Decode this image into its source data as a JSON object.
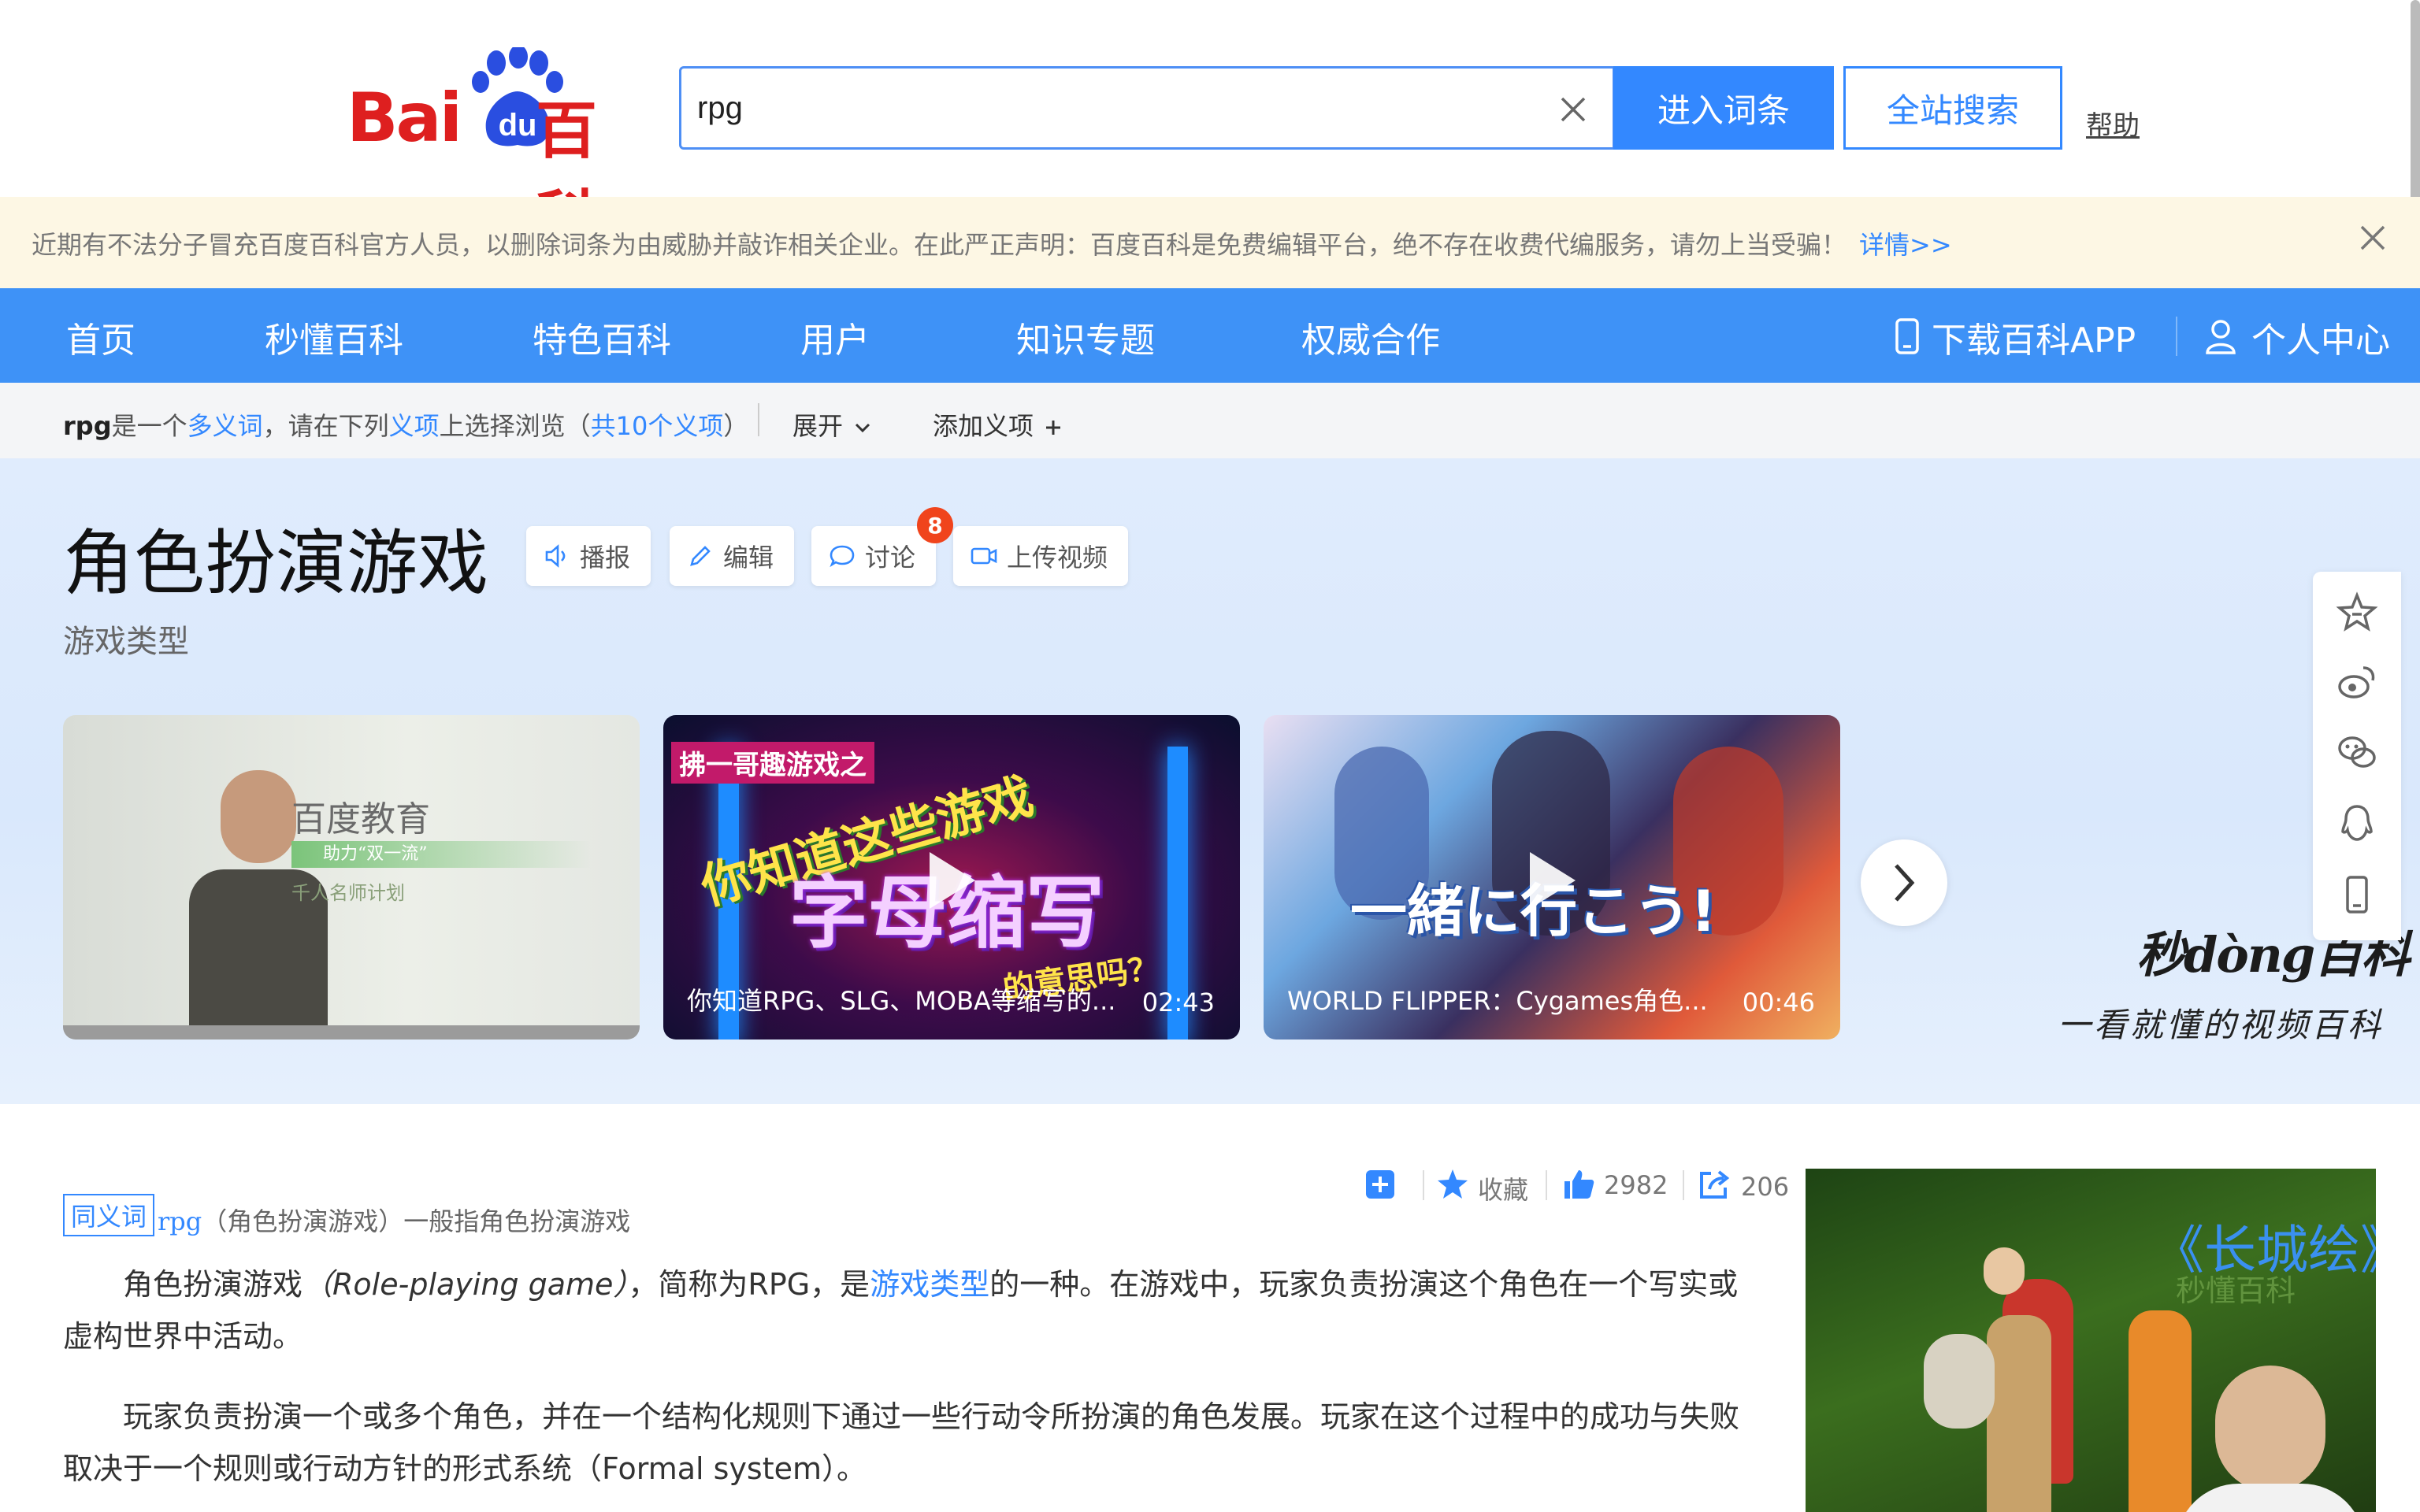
{
  "header": {
    "logo_bai": "Bai",
    "logo_du": "du",
    "logo_baike": "百科",
    "search_value": "rpg",
    "enter_label": "进入词条",
    "site_search_label": "全站搜索",
    "help_label": "帮助"
  },
  "notice": {
    "text": "近期有不法分子冒充百度百科官方人员，以删除词条为由威胁并敲诈相关企业。在此严正声明：百度百科是免费编辑平台，绝不存在收费代编服务，请勿上当受骗！",
    "link": "详情>>"
  },
  "nav": {
    "items": [
      "首页",
      "秒懂百科",
      "特色百科",
      "用户",
      "知识专题",
      "权威合作"
    ],
    "download_app": "下载百科APP",
    "user_center": "个人中心"
  },
  "polysemy": {
    "term": "rpg",
    "is_a": "是一个",
    "polysemy_word": "多义词",
    "choose_prefix": "，请在下列",
    "sense_word": "义项",
    "choose_suffix": "上选择浏览（",
    "count_text": "共10个义项",
    "close_paren": "）",
    "expand_label": "展开",
    "add_sense_label": "添加义项"
  },
  "lemma": {
    "title": "角色扮演游戏",
    "subtitle": "游戏类型",
    "tools": {
      "broadcast": "播报",
      "edit": "编辑",
      "discuss": "讨论",
      "upload_video": "上传视频"
    },
    "discuss_count": "8"
  },
  "videos": [
    {
      "caption": "",
      "duration": "",
      "overlay_title": "百度教育",
      "overlay_sub1": "助力“双一流”",
      "overlay_sub2": "千人名师计划"
    },
    {
      "caption": "你知道RPG、SLG、MOBA等缩写的...",
      "duration": "02:43",
      "overlay_top": "拂一哥趣游戏之",
      "overlay_main": "你知道这些游戏",
      "overlay_big": "字母缩写",
      "overlay_end": "的意思吗？"
    },
    {
      "caption": "WORLD FLIPPER：Cygames角色...",
      "duration": "00:46",
      "overlay_main": "一緒に行こう!"
    }
  ],
  "miaodong": {
    "logo": "秒dòng百科",
    "slogan": "一看就懂的视频百科"
  },
  "actions": {
    "favorite_label": "收藏",
    "like_count": "2982",
    "share_count": "206"
  },
  "synonym": {
    "tag": "同义词",
    "term": "rpg",
    "rest": "（角色扮演游戏）一般指角色扮演游戏"
  },
  "paragraphs": {
    "p1_a": "角色扮演游戏",
    "p1_en": "（Role-playing game）",
    "p1_b": "，简称为RPG，是",
    "p1_link": "游戏类型",
    "p1_c": "的一种。在游戏中，玩家负责扮演这个角色在一个写实或虚构世界中活动。",
    "p2": "玩家负责扮演一个或多个角色，并在一个结构化规则下通过一些行动令所扮演的角色发展。玩家在这个过程中的成功与失败取决于一个规则或行动方针的形式系统（Formal system）。"
  },
  "side_image": {
    "title": "《长城绘》",
    "caption": "秒懂百科"
  },
  "colors": {
    "brand_red": "#de1f1f",
    "accent_blue": "#3388ff",
    "nav_blue": "#3e92f7",
    "badge_red": "#f0441c"
  }
}
